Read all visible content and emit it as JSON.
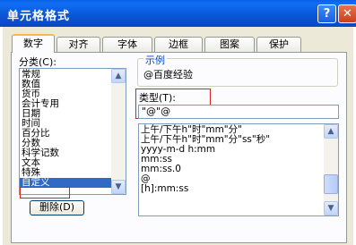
{
  "window": {
    "title": "单元格格式",
    "help_glyph": "?",
    "close_glyph": "✕"
  },
  "tabs": [
    "数字",
    "对齐",
    "字体",
    "边框",
    "图案",
    "保护"
  ],
  "category": {
    "label": "分类(C):",
    "items": [
      "常规",
      "数值",
      "货币",
      "会计专用",
      "日期",
      "时间",
      "百分比",
      "分数",
      "科学记数",
      "文本",
      "特殊",
      "自定义"
    ],
    "selected": "自定义"
  },
  "sample": {
    "label": "示例",
    "value": "@百度经验"
  },
  "type": {
    "label": "类型(T):",
    "value": "\"@\"@",
    "items": [
      "上午/下午h\"时\"mm\"分\"",
      "上午/下午h\"时\"mm\"分\"ss\"秒\"",
      "yyyy-m-d h:mm",
      "mm:ss",
      "mm:ss.0",
      "@",
      "[h]:mm:ss"
    ]
  },
  "delete_button": "删除(D)",
  "scroll_glyphs": {
    "up": "▲",
    "down": "▼"
  }
}
